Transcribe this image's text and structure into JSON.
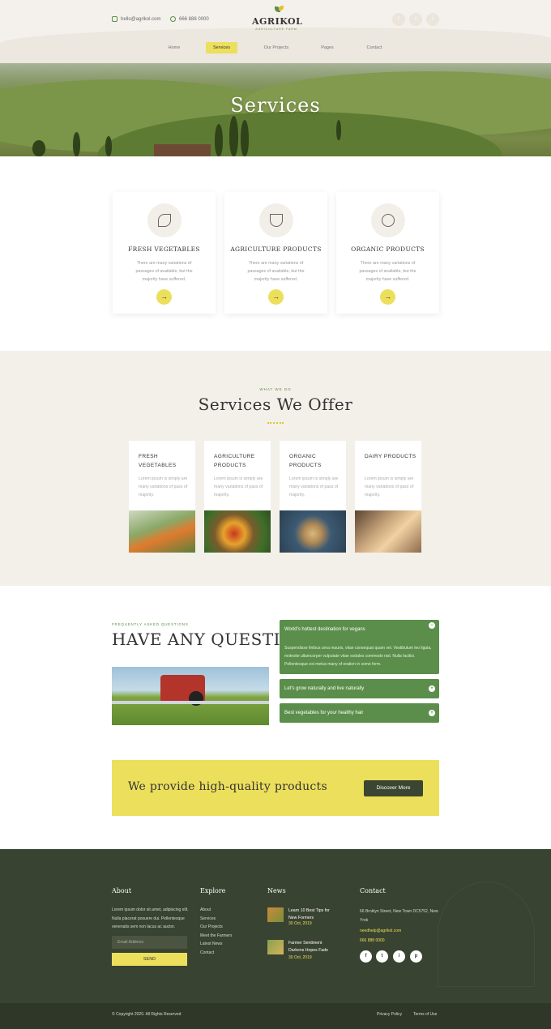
{
  "header": {
    "email": "hello@agrikol.com",
    "phone": "666 888 0000",
    "logo_name": "AGRIKOL",
    "logo_tag": "AGRICULTURE FARM",
    "social": [
      "f",
      "t",
      "i"
    ],
    "nav": [
      {
        "label": "Home"
      },
      {
        "label": "Services",
        "active": true
      },
      {
        "label": "Our Projects"
      },
      {
        "label": "Pages"
      },
      {
        "label": "Contact"
      }
    ]
  },
  "hero": {
    "title": "Services"
  },
  "service_cards": [
    {
      "title": "FRESH VEGETABLES",
      "desc": "There are many variations of passages of available, but the majority have suffered.",
      "icon": "leaf-icon"
    },
    {
      "title": "AGRICULTURE PRODUCTS",
      "desc": "There are many variations of passages of available, but the majority have suffered.",
      "icon": "bowl-icon"
    },
    {
      "title": "ORGANIC PRODUCTS",
      "desc": "There are many variations of passages of available, but the majority have suffered.",
      "icon": "flower-icon"
    }
  ],
  "offer": {
    "kicker": "WHAT WE DO",
    "title": "Services We Offer",
    "cards": [
      {
        "title": "FRESH VEGETABLES",
        "desc": "Lorem ipsum is simply are many variations of pass of majority."
      },
      {
        "title": "AGRICULTURE PRODUCTS",
        "desc": "Lorem ipsum is simply are many variations of pass of majority."
      },
      {
        "title": "ORGANIC PRODUCTS",
        "desc": "Lorem ipsum is simply are many variations of pass of majority."
      },
      {
        "title": "DAIRY PRODUCTS",
        "desc": "Lorem ipsum is simply are many variations of pass of majority."
      }
    ]
  },
  "faq": {
    "kicker": "FREQUENTLY ASKED QUESTIONS",
    "title": "HAVE ANY QUESTIONS?",
    "items": [
      {
        "q": "World's hottest destination for vegans",
        "a": "Suspendisse finibus urna mauris, vitae consequat quam vel. Vestibulum leo ligula, molestie ullamcorper vulputate vitae sodales commodo nisl. Nulla facilisi. Pellentesque est metus many of eration in some form.",
        "toggle": "−"
      },
      {
        "q": "Let's grow naturally and live naturally",
        "toggle": "+"
      },
      {
        "q": "Best vegetables for your healthy hair",
        "toggle": "+"
      }
    ]
  },
  "cta": {
    "text": "We provide high-quality products",
    "button": "Discover More"
  },
  "footer": {
    "about_h": "About",
    "about_text": "Lorem ipsum dolor sit amet, adipiscing elit. Nulla placerat posuere dui. Pellentesque venenatis sem non lacus ac auctor.",
    "email_placeholder": "Email Address",
    "send": "SEND",
    "explore_h": "Explore",
    "explore": [
      "About",
      "Services",
      "Our Projects",
      "Meet the Farmers",
      "Latest News",
      "Contact"
    ],
    "news_h": "News",
    "news": [
      {
        "title": "Learn 10 Best Tips for New Formers",
        "date": "30 Oct, 2019"
      },
      {
        "title": "Farmer Sentiment Darkens Hopes Fade",
        "date": "30 Oct, 2019"
      }
    ],
    "contact_h": "Contact",
    "address": "66 Broklyn Street, New Town DC5752, New Yrok",
    "contact_email": "needhelp@agrikol.com",
    "contact_phone": "666 888 0000",
    "social": [
      "f",
      "t",
      "i",
      "p"
    ]
  },
  "bottom": {
    "copyright": "© Copyright 2020. All Rights Reserved",
    "privacy": "Privacy Policy",
    "terms": "Terms of Use"
  },
  "colors": {
    "green": "#5b8e4a",
    "yellow": "#ecdf5c",
    "dark": "#394331",
    "cream": "#f3f0ea"
  }
}
